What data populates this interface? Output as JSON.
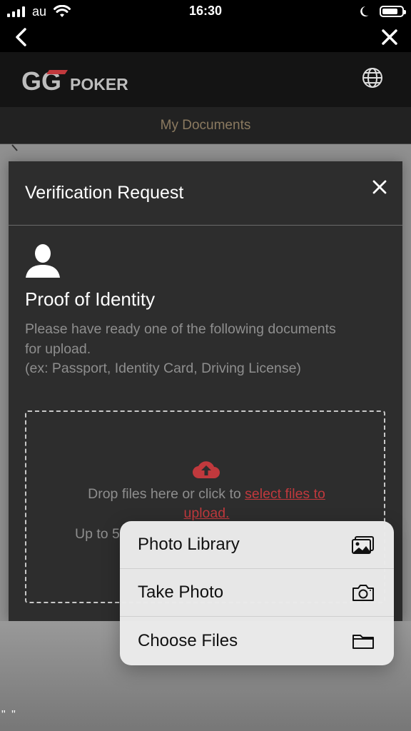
{
  "status_bar": {
    "carrier": "au",
    "time": "16:30"
  },
  "app": {
    "logo_gg": "GG",
    "logo_text": "POKER",
    "page_title": "My Documents"
  },
  "modal": {
    "title": "Verification Request",
    "section_title": "Proof of Identity",
    "description_line1": "Please have ready one of the following documents",
    "description_line2": "for upload.",
    "description_line3": "(ex: Passport, Identity Card, Driving License)",
    "drop_text": "Drop files here or click to ",
    "drop_link_line1": "select files to",
    "drop_link_line2": "upload.",
    "limit_text_partial": "Up to 5"
  },
  "action_menu": {
    "items": [
      {
        "label": "Photo Library",
        "icon": "photo-library-icon"
      },
      {
        "label": "Take Photo",
        "icon": "camera-icon"
      },
      {
        "label": "Choose Files",
        "icon": "folder-icon"
      }
    ]
  },
  "colors": {
    "accent_red": "#c1393d",
    "title_gold": "#8b7a60",
    "modal_bg": "#2d2d2d"
  },
  "bottom_marks": "\" \""
}
